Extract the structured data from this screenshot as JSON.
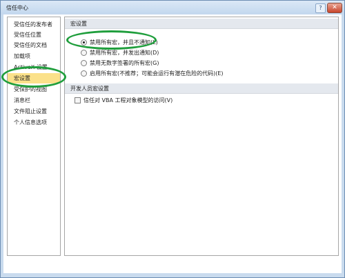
{
  "window": {
    "title": "信任中心",
    "help_icon": "question-icon",
    "close_icon": "close-icon"
  },
  "sidebar": {
    "items": [
      {
        "label": "受信任的发布者",
        "selected": false
      },
      {
        "label": "受信任位置",
        "selected": false
      },
      {
        "label": "受信任的文档",
        "selected": false
      },
      {
        "label": "加载项",
        "selected": false
      },
      {
        "label": "ActiveX 设置",
        "selected": false
      },
      {
        "label": "宏设置",
        "selected": true
      },
      {
        "label": "受保护的视图",
        "selected": false
      },
      {
        "label": "消息栏",
        "selected": false
      },
      {
        "label": "文件阻止设置",
        "selected": false
      },
      {
        "label": "个人信息选项",
        "selected": false
      }
    ]
  },
  "macro_settings": {
    "header": "宏设置",
    "options": [
      {
        "label": "禁用所有宏，并且不通知(L)",
        "selected": true
      },
      {
        "label": "禁用所有宏，并发出通知(D)",
        "selected": false
      },
      {
        "label": "禁用无数字签署的所有宏(G)",
        "selected": false
      },
      {
        "label": "启用所有宏(不推荐；可能会运行有潜在危险的代码)(E)",
        "selected": false
      }
    ]
  },
  "developer_settings": {
    "header": "开发人员宏设置",
    "checkbox_label": "信任对 VBA 工程对象模型的访问(V)",
    "checked": false
  },
  "annotation_color": "#1f9e3c",
  "selection_color": "#fbe18a"
}
